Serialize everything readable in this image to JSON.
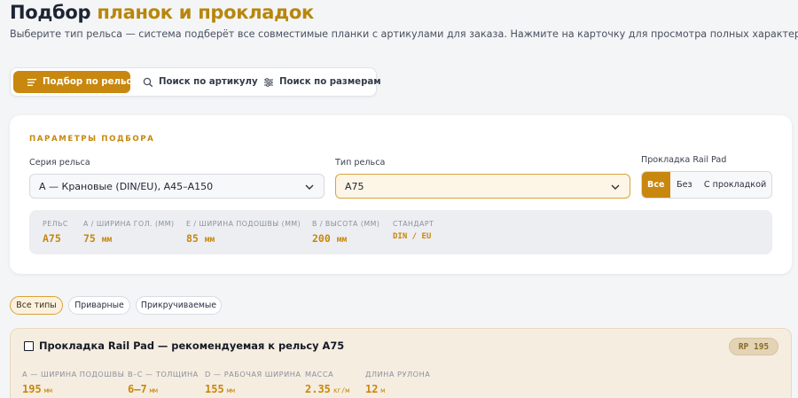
{
  "header": {
    "title_main": "Подбор",
    "title_accent": "планок и прокладок",
    "subtitle": "Выберите тип рельса — система подберёт все совместимые планки с артикулами для заказа. Нажмите на карточку для просмотра полных характеристик."
  },
  "mode_tabs": [
    {
      "label": "Подбор по рельсу",
      "icon": "list-icon",
      "active": true
    },
    {
      "label": "Поиск по артикулу",
      "icon": "search-icon",
      "active": false
    },
    {
      "label": "Поиск по размерам",
      "icon": "sliders-icon",
      "active": false
    }
  ],
  "params": {
    "section_label": "ПАРАМЕТРЫ ПОДБОРА",
    "series_label": "Серия рельса",
    "series_value": "A — Крановые (DIN/EU), A45–A150",
    "type_label": "Тип рельса",
    "type_value": "A75",
    "pad_label": "Прокладка Rail Pad",
    "pad_options": [
      "Все",
      "Без",
      "С прокладкой"
    ],
    "pad_selected": "Все",
    "specs": [
      {
        "label": "РЕЛЬС",
        "value": "A75",
        "unit": ""
      },
      {
        "label": "A / ШИРИНА ГОЛ. (ММ)",
        "value": "75",
        "unit": "мм"
      },
      {
        "label": "E / ШИРИНА ПОДОШВЫ (ММ)",
        "value": "85",
        "unit": "мм"
      },
      {
        "label": "B / ВЫСОТА (ММ)",
        "value": "200",
        "unit": "мм"
      },
      {
        "label": "СТАНДАРТ",
        "value": "DIN / EU",
        "unit": ""
      }
    ]
  },
  "type_filter": {
    "chips": [
      "Все типы",
      "Приварные",
      "Прикручиваемые"
    ],
    "selected": "Все типы"
  },
  "result": {
    "title": "Прокладка Rail Pad — рекомендуемая к рельсу A75",
    "badge": "RP 195",
    "specs": [
      {
        "label": "A — ШИРИНА ПОДОШВЫ",
        "value": "195",
        "unit": "мм"
      },
      {
        "label": "B–C — ТОЛЩИНА",
        "value": "6–7",
        "unit": "мм"
      },
      {
        "label": "D — РАБОЧАЯ ШИРИНА",
        "value": "155",
        "unit": "мм"
      },
      {
        "label": "МАССА",
        "value": "2.35",
        "unit": "кг/м"
      },
      {
        "label": "ДЛИНА РУЛОНА",
        "value": "12",
        "unit": "м"
      }
    ]
  },
  "colors": {
    "accent": "#c8870e",
    "background": "#f4f5f7",
    "result_bg": "#f6ede1"
  }
}
